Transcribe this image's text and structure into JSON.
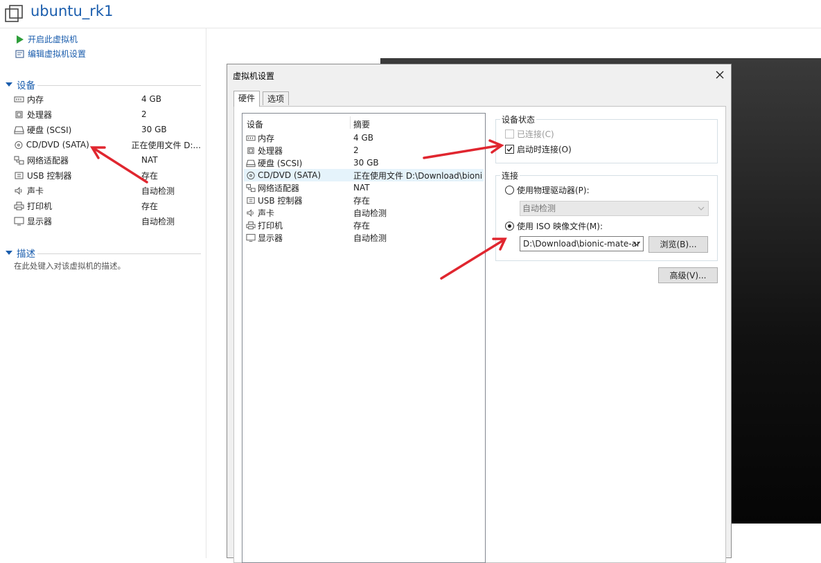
{
  "window": {
    "title": "ubuntu_rk1"
  },
  "actions": [
    {
      "label": "开启此虚拟机",
      "icon": "play-icon"
    },
    {
      "label": "编辑虚拟机设置",
      "icon": "edit-settings-icon"
    }
  ],
  "sidebar": {
    "devices_heading": "设备",
    "devices": [
      {
        "name": "内存",
        "value": "4 GB",
        "icon": "memory-icon"
      },
      {
        "name": "处理器",
        "value": "2",
        "icon": "cpu-icon"
      },
      {
        "name": "硬盘 (SCSI)",
        "value": "30 GB",
        "icon": "hard-disk-icon"
      },
      {
        "name": "CD/DVD (SATA)",
        "value": "正在使用文件 D:...",
        "icon": "cd-dvd-icon"
      },
      {
        "name": "网络适配器",
        "value": "NAT",
        "icon": "network-adapter-icon"
      },
      {
        "name": "USB 控制器",
        "value": "存在",
        "icon": "usb-icon"
      },
      {
        "name": "声卡",
        "value": "自动检测",
        "icon": "sound-card-icon"
      },
      {
        "name": "打印机",
        "value": "存在",
        "icon": "printer-icon"
      },
      {
        "name": "显示器",
        "value": "自动检测",
        "icon": "display-icon"
      }
    ],
    "description_heading": "描述",
    "description_placeholder": "在此处键入对该虚拟机的描述。"
  },
  "dialog": {
    "title": "虚拟机设置",
    "tabs": [
      {
        "label": "硬件",
        "active": true
      },
      {
        "label": "选项",
        "active": false
      }
    ],
    "list": {
      "col_device": "设备",
      "col_summary": "摘要",
      "rows": [
        {
          "name": "内存",
          "value": "4 GB",
          "icon": "memory-icon"
        },
        {
          "name": "处理器",
          "value": "2",
          "icon": "cpu-icon"
        },
        {
          "name": "硬盘 (SCSI)",
          "value": "30 GB",
          "icon": "hard-disk-icon"
        },
        {
          "name": "CD/DVD (SATA)",
          "value": "正在使用文件 D:\\Download\\bionic-mate-ar...",
          "icon": "cd-dvd-icon",
          "selected": true
        },
        {
          "name": "网络适配器",
          "value": "NAT",
          "icon": "network-adapter-icon"
        },
        {
          "name": "USB 控制器",
          "value": "存在",
          "icon": "usb-icon"
        },
        {
          "name": "声卡",
          "value": "自动检测",
          "icon": "sound-card-icon"
        },
        {
          "name": "打印机",
          "value": "存在",
          "icon": "printer-icon"
        },
        {
          "name": "显示器",
          "value": "自动检测",
          "icon": "display-icon"
        }
      ]
    },
    "device_status": {
      "label": "设备状态",
      "connected": {
        "label": "已连接(C)",
        "checked": false,
        "disabled": true
      },
      "connect_at_power_on": {
        "label": "启动时连接(O)",
        "checked": true
      }
    },
    "connection": {
      "label": "连接",
      "physical": {
        "label": "使用物理驱动器(P):",
        "selected": false
      },
      "physical_select": "自动检测",
      "iso": {
        "label": "使用 ISO 映像文件(M):",
        "selected": true
      },
      "iso_path": "D:\\Download\\bionic-mate-ar",
      "browse_label": "浏览(B)..."
    },
    "advanced_label": "高级(V)..."
  },
  "colors": {
    "accent": "#1a5dad",
    "annotation_arrow": "#e0262f"
  }
}
